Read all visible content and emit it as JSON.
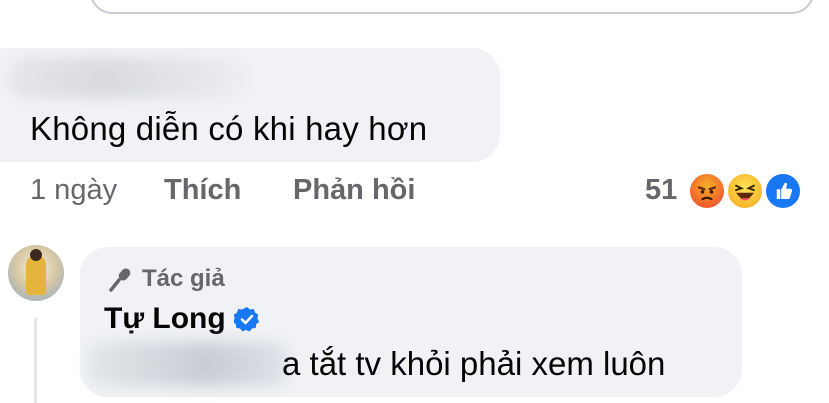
{
  "comment": {
    "text": "Không diễn có khi hay hơn",
    "time": "1 ngày",
    "like_label": "Thích",
    "reply_label": "Phản hồi",
    "reaction_count": "51",
    "reactions": [
      "angry-icon",
      "haha-icon",
      "like-icon"
    ]
  },
  "reply": {
    "badge_label": "Tác giả",
    "author_name": "Tự Long",
    "text_visible": "a tắt tv khỏi phải xem luôn"
  },
  "colors": {
    "bubble": "#f0f2f5",
    "meta_text": "#65676b",
    "like_blue": "#1877f2"
  }
}
